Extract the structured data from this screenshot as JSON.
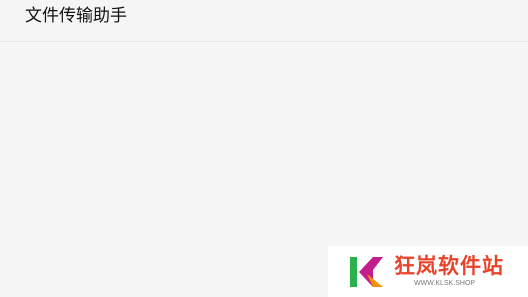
{
  "header": {
    "title": "文件传输助手"
  },
  "watermark": {
    "brand_text": "狂岚软件站",
    "url": "WWW.KLSK.SHOP",
    "logo_letters": "K",
    "colors": {
      "green": "#2bb24c",
      "magenta": "#c21f8c",
      "orange": "#f39200",
      "red": "#e8432a"
    }
  }
}
